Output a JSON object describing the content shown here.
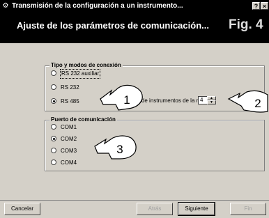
{
  "window": {
    "title": "Transmisión de la configuración a un instrumento...",
    "help_btn": "?",
    "close_btn": "×"
  },
  "header": {
    "title": "Ajuste de los parámetros de comunicación...",
    "figure_label": "Fig. 4"
  },
  "connection_group": {
    "legend": "Tipo y modos de conexión",
    "options": [
      {
        "label": "RS 232 auxiliar",
        "selected": false
      },
      {
        "label": "RS 232",
        "selected": false
      },
      {
        "label": "RS 485",
        "selected": true
      }
    ],
    "instruments_label": "Nº de instrumentos de la red:",
    "instruments_value": "4"
  },
  "port_group": {
    "legend": "Puerto de comunicación",
    "options": [
      {
        "label": "COM1",
        "selected": false
      },
      {
        "label": "COM2",
        "selected": true
      },
      {
        "label": "COM3",
        "selected": false
      },
      {
        "label": "COM4",
        "selected": false
      }
    ]
  },
  "buttons": {
    "cancel": "Cancelar",
    "back": "Atrás",
    "next": "Siguiente",
    "finish": "Fin"
  },
  "callouts": [
    "1",
    "2",
    "3"
  ]
}
